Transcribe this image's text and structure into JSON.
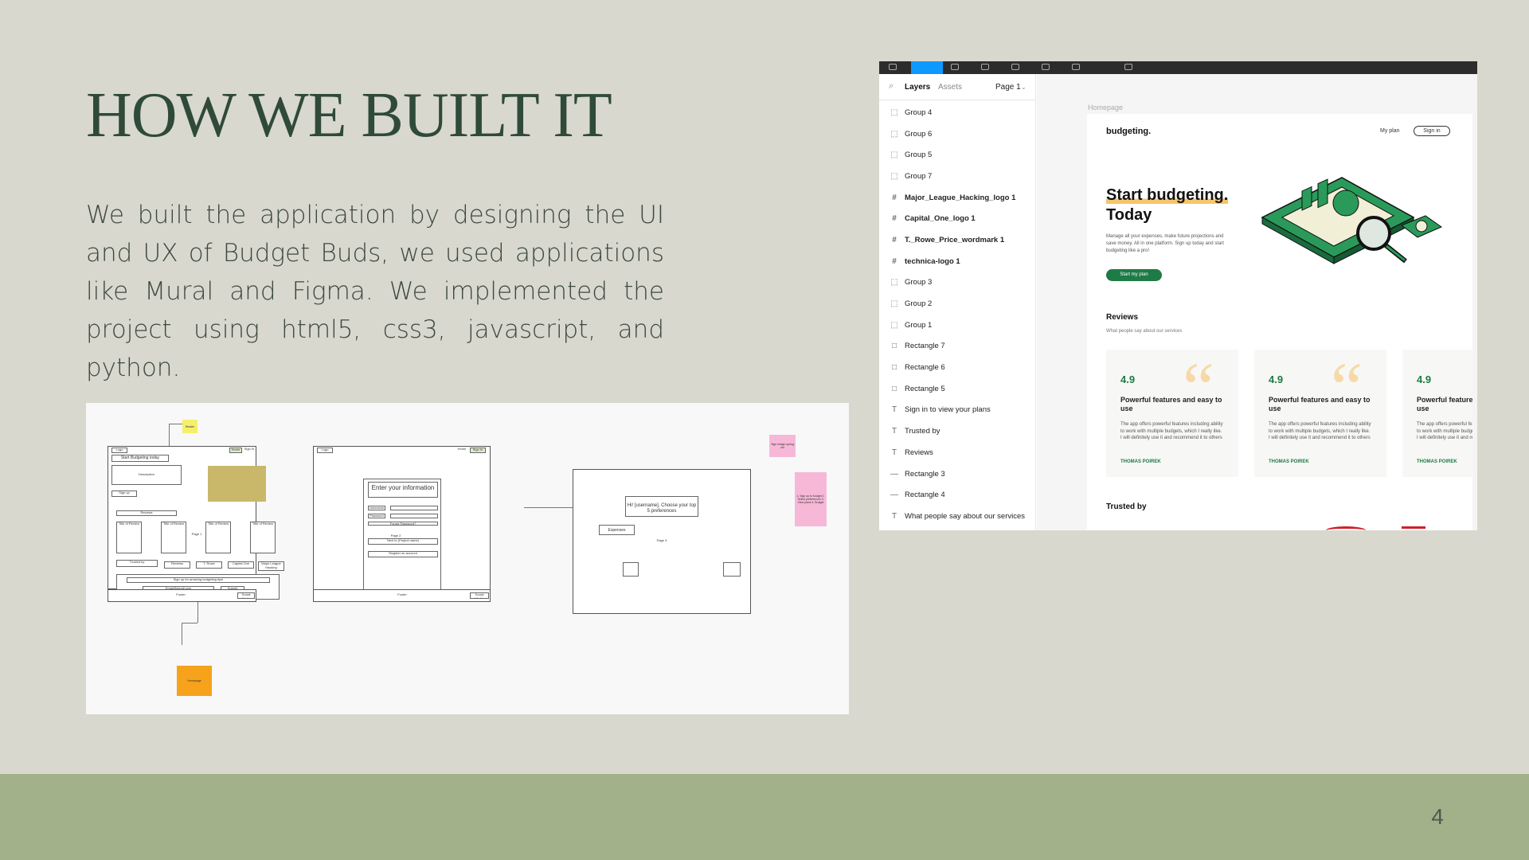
{
  "slide": {
    "title": "HOW WE BUILT IT",
    "body": "We built the application by designing the UI and UX of Budget Buds, we used applications like Mural and Figma. We implemented the project using html5, css3, javascript, and python.",
    "page_number": "4"
  },
  "wireframe": {
    "sticky_yellow": "Header",
    "sticky_orange": "Homepage",
    "sticky_pink_1": "Sign in/sign up/log out",
    "sticky_pink_2": "1. Sign up to budget 2. Select preferences 3. View plans 4. Budget",
    "screen1": {
      "logo": "Logo",
      "home": "Home",
      "sign_in": "Sign In",
      "hero": "Start Budgeting today",
      "description": "Description",
      "sign_up": "Sign up",
      "reviews": "Reviews",
      "page_label": "Page 1",
      "card_titles": [
        "Title of Review",
        "Title of Review",
        "Title of Review",
        "Title of Review"
      ],
      "trusted": [
        "Trusted by",
        "Reviews",
        "T. Rowe",
        "Capital One",
        "Major League Hacking"
      ],
      "signup_prompt": "Sign up for amazing budgeting tips!",
      "email": "Email@email.com",
      "submit": "Submit",
      "footer": "Footer",
      "social": "Social Media"
    },
    "screen2": {
      "logo": "Logo",
      "home": "Home",
      "sign_in": "Sign In",
      "heading": "Enter your information",
      "username": "Username",
      "password": "Password",
      "forgot": "Forgot Password?",
      "next": "Next to (Project name)",
      "register": "Register an account",
      "page_label": "Page 2",
      "footer": "Footer",
      "social": "Social Media"
    },
    "screen3": {
      "greeting": "Hi! [username], Choose your top 5 preferences",
      "expenses": "Expenses",
      "page_label": "Page 3"
    }
  },
  "figma": {
    "tabs": {
      "layers": "Layers",
      "assets": "Assets",
      "page": "Page 1"
    },
    "layers": [
      {
        "name": "Group 4",
        "icon": "group-icon",
        "bold": false
      },
      {
        "name": "Group 6",
        "icon": "group-icon",
        "bold": false
      },
      {
        "name": "Group 5",
        "icon": "group-icon",
        "bold": false
      },
      {
        "name": "Group 7",
        "icon": "group-icon",
        "bold": false
      },
      {
        "name": "Major_League_Hacking_logo 1",
        "icon": "frame-icon",
        "bold": true
      },
      {
        "name": "Capital_One_logo 1",
        "icon": "frame-icon",
        "bold": true
      },
      {
        "name": "T._Rowe_Price_wordmark 1",
        "icon": "frame-icon",
        "bold": true
      },
      {
        "name": "technica-logo 1",
        "icon": "frame-icon",
        "bold": true
      },
      {
        "name": "Group 3",
        "icon": "group-icon",
        "bold": false
      },
      {
        "name": "Group 2",
        "icon": "group-icon",
        "bold": false
      },
      {
        "name": "Group 1",
        "icon": "group-icon",
        "bold": false
      },
      {
        "name": "Rectangle 7",
        "icon": "rectangle-icon",
        "bold": false
      },
      {
        "name": "Rectangle 6",
        "icon": "rectangle-icon",
        "bold": false
      },
      {
        "name": "Rectangle 5",
        "icon": "rectangle-icon",
        "bold": false
      },
      {
        "name": "Sign in to view your plans",
        "icon": "text-icon",
        "bold": false
      },
      {
        "name": "Trusted by",
        "icon": "text-icon",
        "bold": false
      },
      {
        "name": "Reviews",
        "icon": "text-icon",
        "bold": false
      },
      {
        "name": "Rectangle 3",
        "icon": "line-icon",
        "bold": false
      },
      {
        "name": "Rectangle 4",
        "icon": "line-icon",
        "bold": false
      },
      {
        "name": "What people say about our services",
        "icon": "text-icon",
        "bold": false
      }
    ],
    "frame_label": "Homepage",
    "site": {
      "logo": "budgeting.",
      "nav_my_plan": "My plan",
      "nav_sign_in": "Sign in",
      "hero_title_1": "Start budgeting.",
      "hero_title_2": "Today",
      "hero_text": "Manage all your expenses, make future projections and save money. All in one platform. Sign up today and start budgeting like a pro!",
      "hero_cta": "Start my plan",
      "reviews_title": "Reviews",
      "reviews_subtitle": "What people say about our services",
      "reviews": [
        {
          "score": "4.9",
          "title": "Powerful features and easy to use",
          "text": "The app offers powerful features including ability to work with multiple budgets, which I really like. I will definitely use it and recommend it to others",
          "name": "THOMAS POIREK"
        },
        {
          "score": "4.9",
          "title": "Powerful features and easy to use",
          "text": "The app offers powerful features including ability to work with multiple budgets, which I really like. I will definitely use it and recommend it to others",
          "name": "THOMAS POIREK"
        },
        {
          "score": "4.9",
          "title": "Powerful features and easy to use",
          "text": "The app offers powerful features including ability to work with multiple budgets, which I really like. I will definitely use it and recommend it to others",
          "name": "THOMAS POIREK"
        }
      ],
      "trusted_title": "Trusted by"
    },
    "colors": {
      "accent": "#1e7a46",
      "toolbar": "#2c2c2c",
      "active_tool": "#0d99ff",
      "highlight": "#f6c56b"
    }
  },
  "theme": {
    "background": "#d9d8ce",
    "title_color": "#2f4a38",
    "footer_band": "#a3b18a"
  }
}
